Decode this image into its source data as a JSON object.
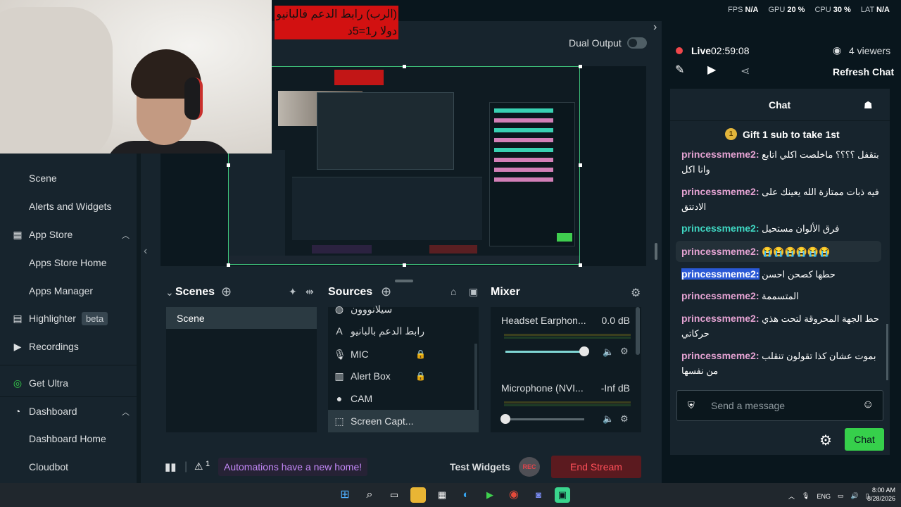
{
  "perf": {
    "fps_label": "FPS",
    "fps": "N/A",
    "gpu_label": "GPU",
    "gpu": "20 %",
    "cpu_label": "CPU",
    "cpu": "30 %",
    "lat_label": "LAT",
    "lat": "N/A"
  },
  "overlay": {
    "line1": "(الرب) رابط الدعم فالبانيو",
    "line2": "دولا ر1=5د"
  },
  "dual_output": {
    "label": "Dual Output"
  },
  "sidebar": {
    "items": [
      {
        "label": "Scene",
        "type": "sub"
      },
      {
        "label": "Alerts and Widgets",
        "type": "sub"
      },
      {
        "label": "App Store",
        "type": "main",
        "icon": "store-icon"
      },
      {
        "label": "Apps Store Home",
        "type": "sub"
      },
      {
        "label": "Apps Manager",
        "type": "sub"
      },
      {
        "label": "Highlighter",
        "type": "main",
        "icon": "highlighter-icon",
        "badge": "beta"
      },
      {
        "label": "Recordings",
        "type": "main",
        "icon": "play-icon"
      },
      {
        "label": "Get Ultra",
        "type": "main",
        "icon": "ultra-icon"
      },
      {
        "label": "Dashboard",
        "type": "main",
        "icon": "dashboard-icon"
      },
      {
        "label": "Dashboard Home",
        "type": "sub"
      },
      {
        "label": "Cloudbot",
        "type": "sub"
      }
    ]
  },
  "scenes": {
    "title": "Scenes",
    "items": [
      "Scene"
    ]
  },
  "sources": {
    "title": "Sources",
    "items": [
      {
        "label": "سيلانووون",
        "icon": "image-icon"
      },
      {
        "label": "رابط الدعم بالبانيو",
        "icon": "text-icon"
      },
      {
        "label": "MIC",
        "icon": "mic-icon"
      },
      {
        "label": "Alert Box",
        "icon": "alert-icon"
      },
      {
        "label": "CAM",
        "icon": "camera-icon"
      },
      {
        "label": "Screen Capt...",
        "icon": "screen-capture-icon"
      }
    ]
  },
  "mixer": {
    "title": "Mixer",
    "channels": [
      {
        "name": "Headset Earphon...",
        "db": "0.0 dB",
        "level": 1.0
      },
      {
        "name": "Microphone (NVI...",
        "db": "-Inf dB",
        "level": 0.0
      }
    ]
  },
  "footer": {
    "automations": "Automations have a new home!",
    "alert_count": "1",
    "test_widgets": "Test Widgets",
    "rec": "REC",
    "end_stream": "End Stream"
  },
  "stream": {
    "live": "Live",
    "time": "02:59:08",
    "viewers": "4 viewers",
    "refresh": "Refresh Chat"
  },
  "chat": {
    "title": "Chat",
    "gift": "Gift 1 sub to take 1st",
    "messages": [
      {
        "user": "princessmeme2:",
        "text": "بتقفل ؟؟؟؟ ماخلصت اكلي اتابع وانا اكل",
        "color": "#e5a3d3"
      },
      {
        "user": "princessmeme2:",
        "text": "فيه ذبات ممتازة الله يعينك على الادتتق",
        "color": "#e5a3d3"
      },
      {
        "user": "princessmeme2:",
        "text": "فرق الألوان مستحيل",
        "color": "#3fd8c3"
      },
      {
        "user": "princessmeme2:",
        "text": "😭😭😭😭😭😭",
        "color": "#e5a3d3"
      },
      {
        "user": "princessmeme2:",
        "text": "حطها كصحن احسن",
        "color": "#ffffff"
      },
      {
        "user": "princessmeme2:",
        "text": "المتسممة",
        "color": "#e5a3d3"
      },
      {
        "user": "princessmeme2:",
        "text": "حط الجهة المحروقة لتحت هذي حركاتي",
        "color": "#e5a3d3"
      },
      {
        "user": "princessmeme2:",
        "text": "بموت عشان كذا تقولون تنقلب من نفسها",
        "color": "#e5a3d3"
      }
    ],
    "input_placeholder": "Send a message",
    "send_label": "Chat"
  },
  "taskbar": {
    "lang": "ENG",
    "time": "8:00 AM",
    "date": "8/28/2026"
  },
  "colors": {
    "accent_green": "#36d04b",
    "end_stream": "#ff4f59",
    "automations": "#c387f7"
  }
}
